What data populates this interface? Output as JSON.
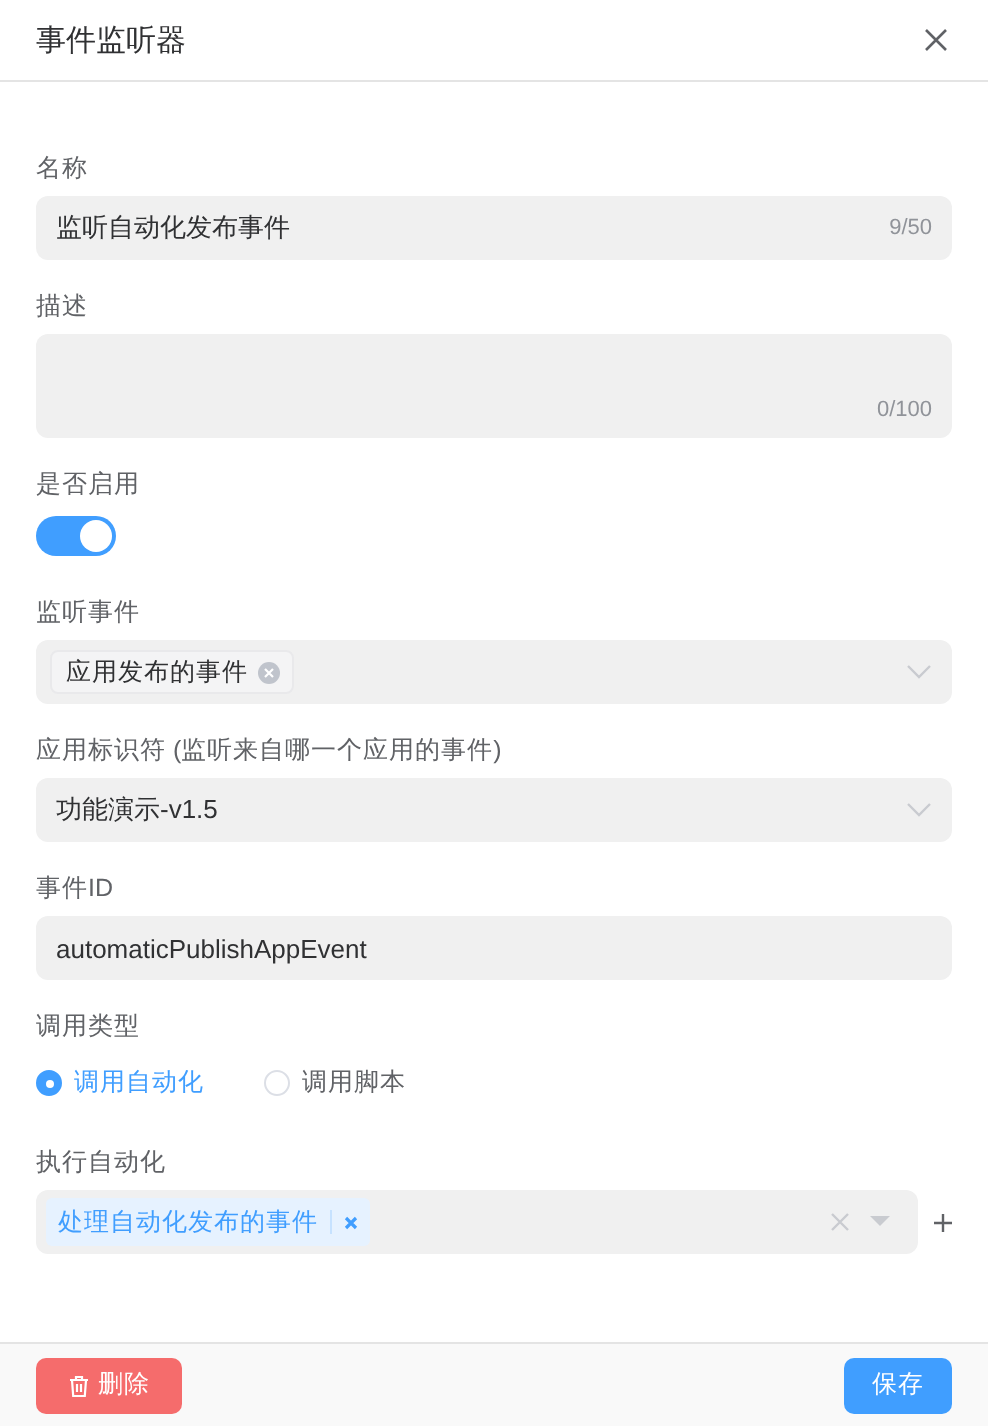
{
  "dialog": {
    "title": "事件监听器"
  },
  "fields": [
    {
      "kind": "text",
      "label": "名称",
      "value": "监听自动化发布事件",
      "counter": "9/50"
    },
    {
      "kind": "textarea",
      "label": "描述",
      "counter": "0/100"
    },
    {
      "kind": "switch",
      "label": "是否启用",
      "on": true
    },
    {
      "kind": "tags",
      "label": "监听事件",
      "tags": [
        "应用发布的事件"
      ]
    },
    {
      "kind": "select",
      "label": "应用标识符 (监听来自哪一个应用的事件)",
      "value": "功能演示-v1.5"
    },
    {
      "kind": "text",
      "label": "事件ID",
      "value": "automaticPublishAppEvent"
    },
    {
      "kind": "radio",
      "label": "调用类型",
      "options": [
        {
          "label": "调用自动化",
          "selected": true
        },
        {
          "label": "调用脚本",
          "selected": false
        }
      ]
    },
    {
      "kind": "multiselect",
      "label": "执行自动化",
      "tags": [
        "处理自动化发布的事件"
      ]
    }
  ],
  "footer": {
    "delete_button": "删除",
    "save_button": "保存"
  }
}
